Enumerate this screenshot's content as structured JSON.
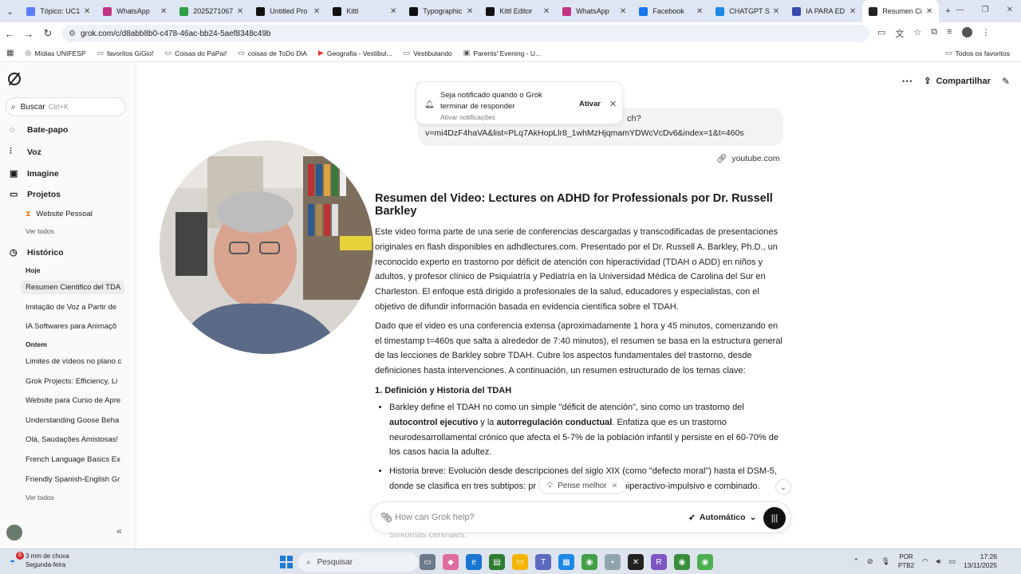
{
  "colors": {
    "accent": "#1e7bd8",
    "grok_button": "#111111",
    "toast_bg": "#ffffff",
    "tab_bar": "#dfe6f3",
    "taskbar": "#dde4ee"
  },
  "browser": {
    "tabs": [
      {
        "label": "Tópico: UC1",
        "icon": "circle-icon",
        "color": "#5c7cfa"
      },
      {
        "label": "WhatsApp",
        "icon": "instagram-icon",
        "color": "#c13584"
      },
      {
        "label": "2025271067",
        "icon": "circle-icon",
        "color": "#2f9e44"
      },
      {
        "label": "Untitled Pro",
        "icon": "globe-icon",
        "color": "#111111"
      },
      {
        "label": "Kittl",
        "icon": "k-icon",
        "color": "#111111"
      },
      {
        "label": "Typographic",
        "icon": "k-icon",
        "color": "#111111"
      },
      {
        "label": "Kittl Editor",
        "icon": "k-icon",
        "color": "#111111"
      },
      {
        "label": "WhatsApp",
        "icon": "instagram-icon",
        "color": "#c13584"
      },
      {
        "label": "Facebook",
        "icon": "facebook-icon",
        "color": "#1877f2"
      },
      {
        "label": "CHATGPT S",
        "icon": "c-icon",
        "color": "#1e88e5"
      },
      {
        "label": "IA PARA ED",
        "icon": "ia-icon",
        "color": "#3949ab"
      },
      {
        "label": "Resumen Ci",
        "icon": "grok-icon",
        "color": "#222222",
        "active": true
      }
    ],
    "url": "grok.com/c/d8abb8b0-c478-46ac-bb24-5aef8348c49b",
    "bookmarks": [
      {
        "label": "Mídias UNIFESP",
        "icon": "globe-icon"
      },
      {
        "label": "favoritos GiGio!",
        "icon": "folder-icon"
      },
      {
        "label": "Coisas do PaPai!",
        "icon": "folder-icon"
      },
      {
        "label": "coisas de ToDo DiA",
        "icon": "folder-icon"
      },
      {
        "label": "Geografia - Vestibul...",
        "icon": "youtube-icon"
      },
      {
        "label": "Vestibulando",
        "icon": "folder-icon"
      },
      {
        "label": "Parents' Evening - U...",
        "icon": "link-icon"
      }
    ],
    "all_bookmarks": "Todos os favoritos"
  },
  "sidebar": {
    "search_label": "Buscar",
    "search_shortcut": "Ctrl+K",
    "chat": "Bate-papo",
    "voice": "Voz",
    "imagine": "Imagine",
    "projects": "Projetos",
    "project_item": "Website Pessoal",
    "see_all": "Ver todos",
    "history": "Histórico",
    "today": "Hoje",
    "today_items": [
      "Resumen Cientifico del TDA",
      "Imitação de Voz a Partir de",
      "IA Softwares para Animaçõ"
    ],
    "yesterday": "Ontem",
    "yesterday_items": [
      "Limites de vídeos no plano c",
      "Grok Projects: Efficiency, Li",
      "Website para Curso de Apre",
      "Understanding Goose Beha",
      "Olá, Saudações Amistosas!",
      "French Language Basics Ex",
      "Friendly Spanish-English Gr"
    ],
    "see_all_history": "Ver todos"
  },
  "header": {
    "share": "Compartilhar"
  },
  "toast": {
    "title": "Seja notificado quando o Grok terminar de responder",
    "subtitle": "Ativar notificações",
    "action": "Ativar"
  },
  "user_message": {
    "partial_top": "ch?",
    "line": "v=mi4DzF4haVA&list=PLq7AkHopLlr8_1whMzHjqmamYDWcVcDv6&index=1&t=460s",
    "link": "youtube.com"
  },
  "response": {
    "title": "Resumen del Video: Lectures on ADHD for Professionals por Dr. Russell Barkley",
    "p1": "Este video forma parte de una serie de conferencias descargadas y transcodificadas de presentaciones originales en flash disponibles en adhdlectures.com. Presentado por el Dr. Russell A. Barkley, Ph.D., un reconocido experto en trastorno por déficit de atención con hiperactividad (TDAH o ADD) en niños y adultos, y profesor clínico de Psiquiatría y Pediatría en la Universidad Médica de Carolina del Sur en Charleston. El enfoque está dirigido a profesionales de la salud, educadores y especialistas, con el objetivo de difundir información basada en evidencia científica sobre el TDAH.",
    "p2": "Dado que el video es una conferencia extensa (aproximadamente 1 hora y 45 minutos, comenzando en el timestamp t=460s que salta a alrededor de 7:40 minutos), el resumen se basa en la estructura general de las lecciones de Barkley sobre TDAH. Cubre los aspectos fundamentales del trastorno, desde definiciones hasta intervenciones. A continuación, un resumen estructurado de los temas clave:",
    "h2": "1. Definición y Historia del TDAH",
    "b1_pre": "Barkley define el TDAH no como un simple \"déficit de atención\", sino como un trastorno del ",
    "b1_bold1": "autocontrol ejecutivo",
    "b1_mid": " y la ",
    "b1_bold2": "autorregulación conductual",
    "b1_post": ". Enfatiza que es un trastorno neurodesarrollamental crónico que afecta el 5-7% de la población infantil y persiste en el 60-70% de los casos hacia la adultez.",
    "b2_pre": "Historia breve: Evolución desde descripciones del siglo XIX (como \"defecto moral\") hasta el DSM-5, donde se clasifica en tres subtipos: pr",
    "b2_post": "atento, hiperactivo-impulsivo e combinado.",
    "faded": "Síntomas centrales:"
  },
  "composer": {
    "think_chip": "Pense melhor",
    "placeholder": "How can Grok help?",
    "mode": "Automático"
  },
  "taskbar": {
    "weather_badge": "6",
    "weather_line1": "3 mm de chuva",
    "weather_line2": "Segunda-feira",
    "search": "Pesquisar",
    "lang1": "POR",
    "lang2": "PTB2",
    "time": "17:26",
    "date": "13/11/2025"
  }
}
